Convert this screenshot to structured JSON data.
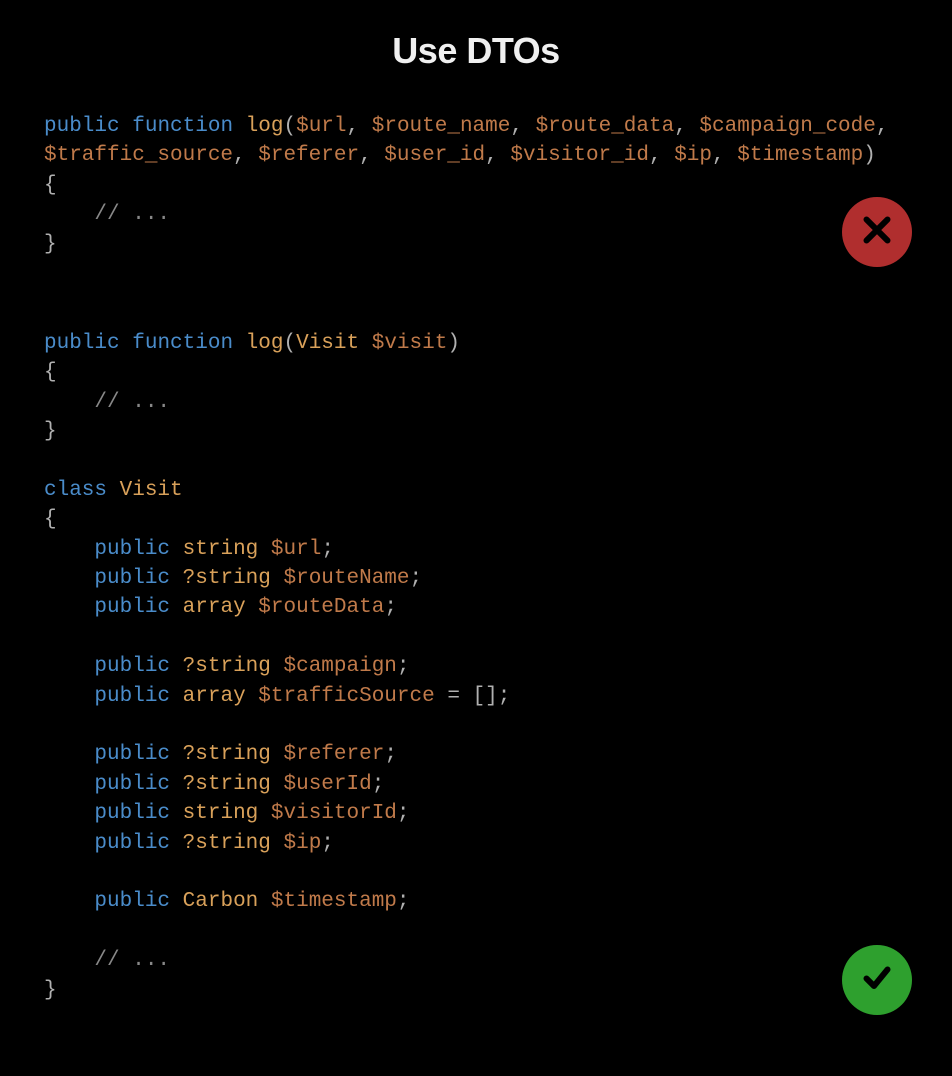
{
  "title": "Use DTOs",
  "bad": {
    "tokens": [
      {
        "t": "public",
        "c": "kw"
      },
      {
        "t": " ",
        "c": ""
      },
      {
        "t": "function",
        "c": "kw"
      },
      {
        "t": " ",
        "c": ""
      },
      {
        "t": "log",
        "c": "fn"
      },
      {
        "t": "(",
        "c": "punct"
      },
      {
        "t": "$url",
        "c": "var"
      },
      {
        "t": ", ",
        "c": "punct"
      },
      {
        "t": "$route_name",
        "c": "var"
      },
      {
        "t": ", ",
        "c": "punct"
      },
      {
        "t": "$route_data",
        "c": "var"
      },
      {
        "t": ", ",
        "c": "punct"
      },
      {
        "t": "$campaign_code",
        "c": "var"
      },
      {
        "t": ",",
        "c": "punct"
      },
      {
        "t": "\n",
        "c": ""
      },
      {
        "t": "$traffic_source",
        "c": "var"
      },
      {
        "t": ", ",
        "c": "punct"
      },
      {
        "t": "$referer",
        "c": "var"
      },
      {
        "t": ", ",
        "c": "punct"
      },
      {
        "t": "$user_id",
        "c": "var"
      },
      {
        "t": ", ",
        "c": "punct"
      },
      {
        "t": "$visitor_id",
        "c": "var"
      },
      {
        "t": ", ",
        "c": "punct"
      },
      {
        "t": "$ip",
        "c": "var"
      },
      {
        "t": ", ",
        "c": "punct"
      },
      {
        "t": "$timestamp",
        "c": "var"
      },
      {
        "t": ")",
        "c": "punct"
      },
      {
        "t": "\n",
        "c": ""
      },
      {
        "t": "{",
        "c": "punct"
      },
      {
        "t": "\n    ",
        "c": ""
      },
      {
        "t": "// ...",
        "c": "comment"
      },
      {
        "t": "\n",
        "c": ""
      },
      {
        "t": "}",
        "c": "punct"
      }
    ]
  },
  "good": {
    "tokens": [
      {
        "t": "public",
        "c": "kw"
      },
      {
        "t": " ",
        "c": ""
      },
      {
        "t": "function",
        "c": "kw"
      },
      {
        "t": " ",
        "c": ""
      },
      {
        "t": "log",
        "c": "fn"
      },
      {
        "t": "(",
        "c": "punct"
      },
      {
        "t": "Visit",
        "c": "type"
      },
      {
        "t": " ",
        "c": ""
      },
      {
        "t": "$visit",
        "c": "var"
      },
      {
        "t": ")",
        "c": "punct"
      },
      {
        "t": "\n",
        "c": ""
      },
      {
        "t": "{",
        "c": "punct"
      },
      {
        "t": "\n    ",
        "c": ""
      },
      {
        "t": "// ...",
        "c": "comment"
      },
      {
        "t": "\n",
        "c": ""
      },
      {
        "t": "}",
        "c": "punct"
      },
      {
        "t": "\n\n",
        "c": ""
      },
      {
        "t": "class",
        "c": "kw"
      },
      {
        "t": " ",
        "c": ""
      },
      {
        "t": "Visit",
        "c": "type"
      },
      {
        "t": "\n",
        "c": ""
      },
      {
        "t": "{",
        "c": "punct"
      },
      {
        "t": "\n    ",
        "c": ""
      },
      {
        "t": "public",
        "c": "kw"
      },
      {
        "t": " ",
        "c": ""
      },
      {
        "t": "string",
        "c": "type"
      },
      {
        "t": " ",
        "c": ""
      },
      {
        "t": "$url",
        "c": "var"
      },
      {
        "t": ";",
        "c": "punct"
      },
      {
        "t": "\n    ",
        "c": ""
      },
      {
        "t": "public",
        "c": "kw"
      },
      {
        "t": " ",
        "c": ""
      },
      {
        "t": "?string",
        "c": "type"
      },
      {
        "t": " ",
        "c": ""
      },
      {
        "t": "$routeName",
        "c": "var"
      },
      {
        "t": ";",
        "c": "punct"
      },
      {
        "t": "\n    ",
        "c": ""
      },
      {
        "t": "public",
        "c": "kw"
      },
      {
        "t": " ",
        "c": ""
      },
      {
        "t": "array",
        "c": "type"
      },
      {
        "t": " ",
        "c": ""
      },
      {
        "t": "$routeData",
        "c": "var"
      },
      {
        "t": ";",
        "c": "punct"
      },
      {
        "t": "\n\n    ",
        "c": ""
      },
      {
        "t": "public",
        "c": "kw"
      },
      {
        "t": " ",
        "c": ""
      },
      {
        "t": "?string",
        "c": "type"
      },
      {
        "t": " ",
        "c": ""
      },
      {
        "t": "$campaign",
        "c": "var"
      },
      {
        "t": ";",
        "c": "punct"
      },
      {
        "t": "\n    ",
        "c": ""
      },
      {
        "t": "public",
        "c": "kw"
      },
      {
        "t": " ",
        "c": ""
      },
      {
        "t": "array",
        "c": "type"
      },
      {
        "t": " ",
        "c": ""
      },
      {
        "t": "$trafficSource",
        "c": "var"
      },
      {
        "t": " = [];",
        "c": "punct"
      },
      {
        "t": "\n\n    ",
        "c": ""
      },
      {
        "t": "public",
        "c": "kw"
      },
      {
        "t": " ",
        "c": ""
      },
      {
        "t": "?string",
        "c": "type"
      },
      {
        "t": " ",
        "c": ""
      },
      {
        "t": "$referer",
        "c": "var"
      },
      {
        "t": ";",
        "c": "punct"
      },
      {
        "t": "\n    ",
        "c": ""
      },
      {
        "t": "public",
        "c": "kw"
      },
      {
        "t": " ",
        "c": ""
      },
      {
        "t": "?string",
        "c": "type"
      },
      {
        "t": " ",
        "c": ""
      },
      {
        "t": "$userId",
        "c": "var"
      },
      {
        "t": ";",
        "c": "punct"
      },
      {
        "t": "\n    ",
        "c": ""
      },
      {
        "t": "public",
        "c": "kw"
      },
      {
        "t": " ",
        "c": ""
      },
      {
        "t": "string",
        "c": "type"
      },
      {
        "t": " ",
        "c": ""
      },
      {
        "t": "$visitorId",
        "c": "var"
      },
      {
        "t": ";",
        "c": "punct"
      },
      {
        "t": "\n    ",
        "c": ""
      },
      {
        "t": "public",
        "c": "kw"
      },
      {
        "t": " ",
        "c": ""
      },
      {
        "t": "?string",
        "c": "type"
      },
      {
        "t": " ",
        "c": ""
      },
      {
        "t": "$ip",
        "c": "var"
      },
      {
        "t": ";",
        "c": "punct"
      },
      {
        "t": "\n\n    ",
        "c": ""
      },
      {
        "t": "public",
        "c": "kw"
      },
      {
        "t": " ",
        "c": ""
      },
      {
        "t": "Carbon",
        "c": "type"
      },
      {
        "t": " ",
        "c": ""
      },
      {
        "t": "$timestamp",
        "c": "var"
      },
      {
        "t": ";",
        "c": "punct"
      },
      {
        "t": "\n\n    ",
        "c": ""
      },
      {
        "t": "// ...",
        "c": "comment"
      },
      {
        "t": "\n",
        "c": ""
      },
      {
        "t": "}",
        "c": "punct"
      }
    ]
  }
}
